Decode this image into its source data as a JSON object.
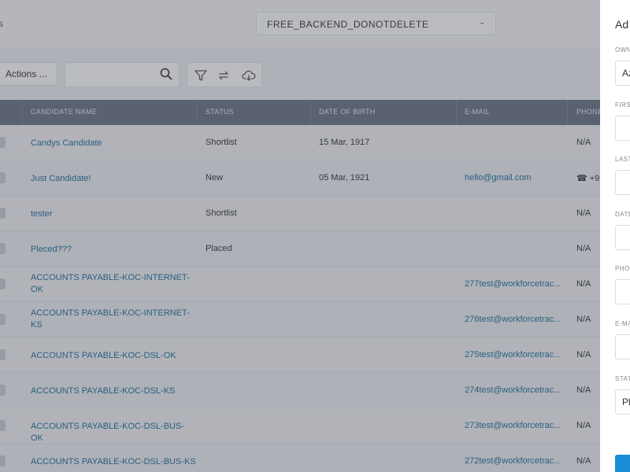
{
  "topbar": {
    "left_text": "s",
    "database_select": "FREE_BACKEND_DONOTDELETE"
  },
  "toolbar": {
    "actions_label": "Actions ...",
    "search_placeholder": ""
  },
  "table": {
    "columns": [
      "CANDIDATE NAME",
      "STATUS",
      "DATE OF BIRTH",
      "E-MAIL",
      "PHONE"
    ],
    "rows": [
      {
        "name": "Candys Candidate",
        "status": "Shortlist",
        "dob": "15 Mar, 1917",
        "email": "",
        "phone": "N/A"
      },
      {
        "name": "Just Candidate!",
        "status": "New",
        "dob": "05 Mar, 1921",
        "email": "hello@gmail.com",
        "phone": "☎ +9"
      },
      {
        "name": "tester",
        "status": "Shortlist",
        "dob": "",
        "email": "",
        "phone": "N/A"
      },
      {
        "name": "Pleced???",
        "status": "Placed",
        "dob": "",
        "email": "",
        "phone": "N/A"
      },
      {
        "name": "ACCOUNTS PAYABLE-KOC-INTERNET-OK",
        "status": "",
        "dob": "",
        "email": "277test@workforcetrac...",
        "phone": "N/A"
      },
      {
        "name": "ACCOUNTS PAYABLE-KOC-INTERNET-KS",
        "status": "",
        "dob": "",
        "email": "276test@workforcetrac...",
        "phone": "N/A"
      },
      {
        "name": "ACCOUNTS PAYABLE-KOC-DSL-OK",
        "status": "",
        "dob": "",
        "email": "275test@workforcetrac...",
        "phone": "N/A"
      },
      {
        "name": "ACCOUNTS PAYABLE-KOC-DSL-KS",
        "status": "",
        "dob": "",
        "email": "274test@workforcetrac...",
        "phone": "N/A"
      },
      {
        "name": "ACCOUNTS PAYABLE-KOC-DSL-BUS-OK",
        "status": "",
        "dob": "",
        "email": "273test@workforcetrac...",
        "phone": "N/A"
      },
      {
        "name": "ACCOUNTS PAYABLE-KOC-DSL-BUS-KS",
        "status": "",
        "dob": "",
        "email": "272test@workforcetrac...",
        "phone": "N/A"
      }
    ]
  },
  "panel": {
    "title": "Ad",
    "fields": [
      {
        "label": "OWN",
        "value": "Az"
      },
      {
        "label": "FIRS",
        "value": ""
      },
      {
        "label": "LAST",
        "value": ""
      },
      {
        "label": "DATE",
        "value": ""
      },
      {
        "label": "PHO",
        "value": ""
      },
      {
        "label": "E-MA",
        "value": ""
      },
      {
        "label": "STAT",
        "value": "Pl"
      }
    ]
  }
}
